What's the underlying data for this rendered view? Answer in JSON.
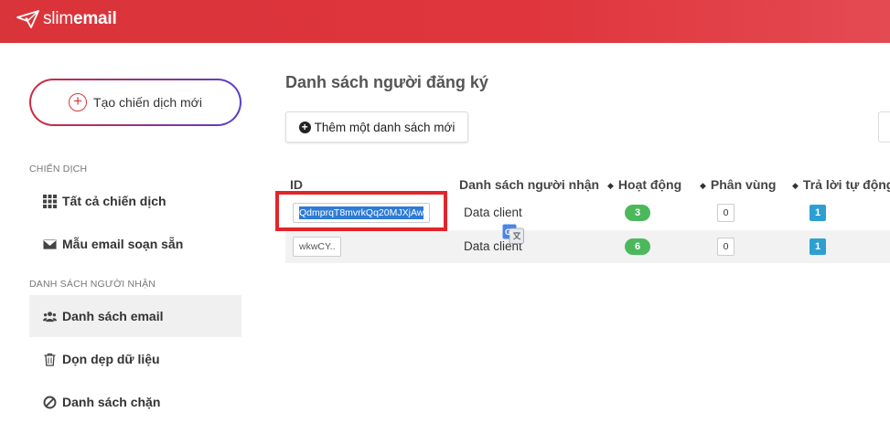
{
  "app": {
    "logo_light": "slim",
    "logo_bold": "email",
    "brand_color": "#e0353d"
  },
  "sidebar": {
    "create_button_label": "Tạo chiến dịch mới",
    "campaign_section": "CHIẾN DỊCH",
    "campaign_items": [
      {
        "label": "Tất cả chiến dịch",
        "icon": "grid-icon"
      },
      {
        "label": "Mẫu email soạn sẵn",
        "icon": "envelope-icon"
      }
    ],
    "recipients_section": "DANH SÁCH NGƯỜI NHẬN",
    "recipient_items": [
      {
        "label": "Danh sách email",
        "icon": "users-icon",
        "active": true
      },
      {
        "label": "Dọn dẹp dữ liệu",
        "icon": "trash-icon"
      },
      {
        "label": "Danh sách chặn",
        "icon": "ban-icon"
      }
    ]
  },
  "main": {
    "title": "Danh sách người đăng ký",
    "add_list_label": "Thêm một danh sách mới",
    "table": {
      "columns": [
        "ID",
        "Danh sách người nhận",
        "Hoạt động",
        "Phân vùng",
        "Trả lời tự động"
      ],
      "rows": [
        {
          "id": "QdmprqT8mvrkQq20MJXjAw",
          "name": "Data client",
          "active": "3",
          "segments": "0",
          "autoresponders": "1"
        },
        {
          "id": "wkwCY..",
          "name": "Data client",
          "active": "6",
          "segments": "0",
          "autoresponders": "1"
        }
      ]
    }
  }
}
